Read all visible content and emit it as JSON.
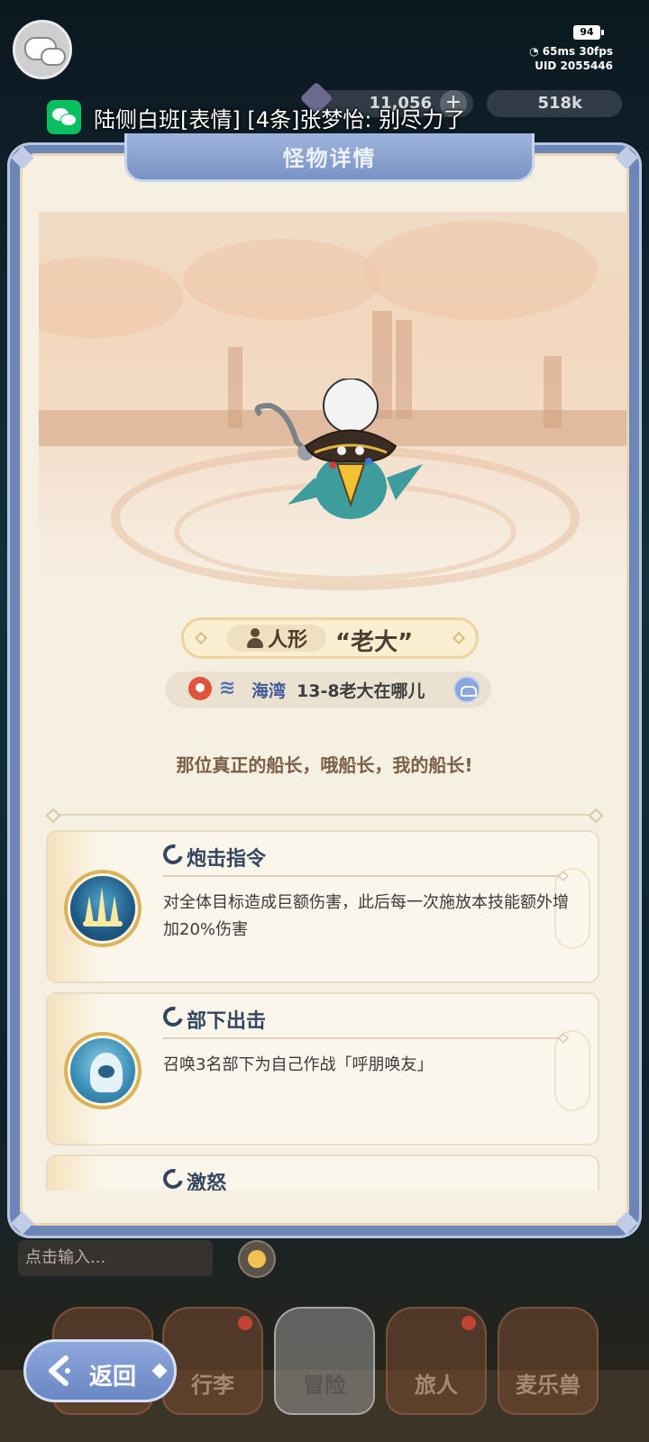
{
  "status_bar": {
    "battery": "94",
    "ping": "65ms",
    "fps": "30fps",
    "uid": "UID 2055446"
  },
  "hud": {
    "currency_1": "11,056",
    "currency_2": "518k"
  },
  "notification": {
    "app": "wechat",
    "text": "陆侧白班[表情] [4条]张梦怡: 别尽力了"
  },
  "modal": {
    "title": "怪物详情"
  },
  "monster": {
    "type": "人形",
    "name": "“老大”",
    "region": "海湾",
    "stage": "13-8老大在哪儿",
    "quote": "那位真正的船长，哦船长，我的船长!"
  },
  "skills": [
    {
      "name": "炮击指令",
      "desc": "对全体目标造成巨额伤害，此后每一次施放本技能额外增加20%伤害"
    },
    {
      "name": "部下出击",
      "desc": "召唤3名部下为自己作战「呼朋唤友」"
    },
    {
      "name": "激怒",
      "desc": ""
    }
  ],
  "chat": {
    "placeholder": "点击输入..."
  },
  "nav": {
    "items": [
      "",
      "行李",
      "冒险",
      "旅人",
      "麦乐兽"
    ]
  },
  "back_button": {
    "label": "返回"
  },
  "colors": {
    "modal_frame": "#6d86b8",
    "modal_bg": "#f6f0e3",
    "accent_blue": "#3e5d9a",
    "skill_title": "#34465e"
  }
}
